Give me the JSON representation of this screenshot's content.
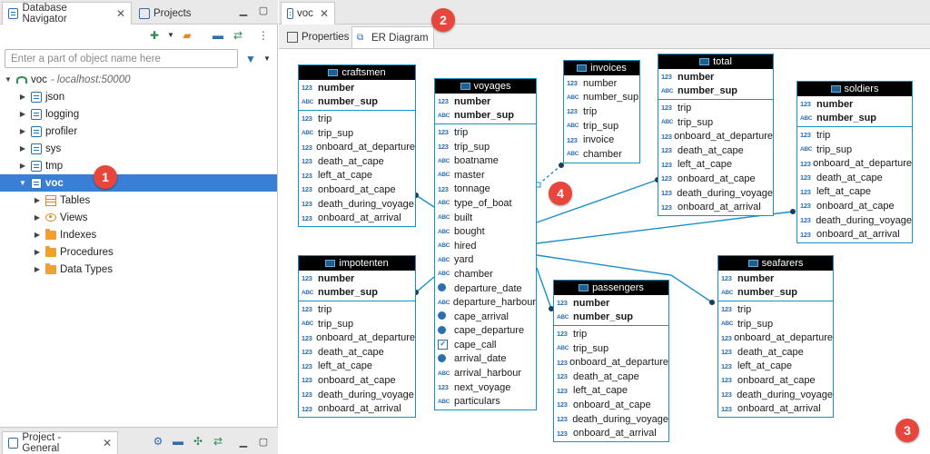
{
  "left_panel": {
    "tabs": [
      {
        "label": "Database Navigator",
        "active": true
      },
      {
        "label": "Projects",
        "active": false
      }
    ],
    "filter": {
      "placeholder": "Enter a part of object name here",
      "value": ""
    },
    "tree": [
      {
        "label": "voc",
        "sub": "- localhost:50000",
        "level": 0,
        "expanded": true,
        "icon": "connection-icon"
      },
      {
        "label": "json",
        "level": 1,
        "icon": "schema-icon"
      },
      {
        "label": "logging",
        "level": 1,
        "icon": "schema-icon"
      },
      {
        "label": "profiler",
        "level": 1,
        "icon": "schema-icon"
      },
      {
        "label": "sys",
        "level": 1,
        "icon": "schema-icon"
      },
      {
        "label": "tmp",
        "level": 1,
        "icon": "schema-icon"
      },
      {
        "label": "voc",
        "level": 1,
        "icon": "schema-icon",
        "selected": true,
        "expanded": true
      },
      {
        "label": "Tables",
        "level": 2,
        "icon": "tables-icon"
      },
      {
        "label": "Views",
        "level": 2,
        "icon": "views-icon"
      },
      {
        "label": "Indexes",
        "level": 2,
        "icon": "folder-icon"
      },
      {
        "label": "Procedures",
        "level": 2,
        "icon": "folder-icon"
      },
      {
        "label": "Data Types",
        "level": 2,
        "icon": "folder-icon"
      }
    ],
    "bottom_tab": {
      "label": "Project - General"
    }
  },
  "editor": {
    "tab": {
      "label": "voc"
    },
    "subtabs": [
      {
        "label": "Properties",
        "active": false
      },
      {
        "label": "ER Diagram",
        "active": true
      }
    ]
  },
  "badges": [
    "1",
    "2",
    "3",
    "4"
  ],
  "entities": {
    "craftsmen": {
      "name": "craftsmen",
      "keys": [
        {
          "t": "123",
          "n": "number"
        },
        {
          "t": "ABC",
          "n": "number_sup"
        }
      ],
      "cols": [
        {
          "t": "123",
          "n": "trip"
        },
        {
          "t": "ABC",
          "n": "trip_sup"
        },
        {
          "t": "123",
          "n": "onboard_at_departure"
        },
        {
          "t": "123",
          "n": "death_at_cape"
        },
        {
          "t": "123",
          "n": "left_at_cape"
        },
        {
          "t": "123",
          "n": "onboard_at_cape"
        },
        {
          "t": "123",
          "n": "death_during_voyage"
        },
        {
          "t": "123",
          "n": "onboard_at_arrival"
        }
      ]
    },
    "impotenten": {
      "name": "impotenten",
      "keys": [
        {
          "t": "123",
          "n": "number"
        },
        {
          "t": "ABC",
          "n": "number_sup"
        }
      ],
      "cols": [
        {
          "t": "123",
          "n": "trip"
        },
        {
          "t": "ABC",
          "n": "trip_sup"
        },
        {
          "t": "123",
          "n": "onboard_at_departure"
        },
        {
          "t": "123",
          "n": "death_at_cape"
        },
        {
          "t": "123",
          "n": "left_at_cape"
        },
        {
          "t": "123",
          "n": "onboard_at_cape"
        },
        {
          "t": "123",
          "n": "death_during_voyage"
        },
        {
          "t": "123",
          "n": "onboard_at_arrival"
        }
      ]
    },
    "voyages": {
      "name": "voyages",
      "keys": [
        {
          "t": "123",
          "n": "number"
        },
        {
          "t": "ABC",
          "n": "number_sup"
        }
      ],
      "cols": [
        {
          "t": "123",
          "n": "trip"
        },
        {
          "t": "123",
          "n": "trip_sup"
        },
        {
          "t": "ABC",
          "n": "boatname"
        },
        {
          "t": "ABC",
          "n": "master"
        },
        {
          "t": "123",
          "n": "tonnage"
        },
        {
          "t": "ABC",
          "n": "type_of_boat"
        },
        {
          "t": "ABC",
          "n": "built"
        },
        {
          "t": "ABC",
          "n": "bought"
        },
        {
          "t": "ABC",
          "n": "hired"
        },
        {
          "t": "ABC",
          "n": "yard"
        },
        {
          "t": "ABC",
          "n": "chamber"
        },
        {
          "t": "date",
          "n": "departure_date"
        },
        {
          "t": "ABC",
          "n": "departure_harbour"
        },
        {
          "t": "date",
          "n": "cape_arrival"
        },
        {
          "t": "date",
          "n": "cape_departure"
        },
        {
          "t": "bool",
          "n": "cape_call"
        },
        {
          "t": "date",
          "n": "arrival_date"
        },
        {
          "t": "ABC",
          "n": "arrival_harbour"
        },
        {
          "t": "123",
          "n": "next_voyage"
        },
        {
          "t": "ABC",
          "n": "particulars"
        }
      ]
    },
    "invoices": {
      "name": "invoices",
      "keys": [],
      "cols": [
        {
          "t": "123",
          "n": "number"
        },
        {
          "t": "ABC",
          "n": "number_sup"
        },
        {
          "t": "123",
          "n": "trip"
        },
        {
          "t": "ABC",
          "n": "trip_sup"
        },
        {
          "t": "123",
          "n": "invoice"
        },
        {
          "t": "ABC",
          "n": "chamber"
        }
      ]
    },
    "total": {
      "name": "total",
      "keys": [
        {
          "t": "123",
          "n": "number"
        },
        {
          "t": "ABC",
          "n": "number_sup"
        }
      ],
      "cols": [
        {
          "t": "123",
          "n": "trip"
        },
        {
          "t": "ABC",
          "n": "trip_sup"
        },
        {
          "t": "123",
          "n": "onboard_at_departure"
        },
        {
          "t": "123",
          "n": "death_at_cape"
        },
        {
          "t": "123",
          "n": "left_at_cape"
        },
        {
          "t": "123",
          "n": "onboard_at_cape"
        },
        {
          "t": "123",
          "n": "death_during_voyage"
        },
        {
          "t": "123",
          "n": "onboard_at_arrival"
        }
      ]
    },
    "soldiers": {
      "name": "soldiers",
      "keys": [
        {
          "t": "123",
          "n": "number"
        },
        {
          "t": "ABC",
          "n": "number_sup"
        }
      ],
      "cols": [
        {
          "t": "123",
          "n": "trip"
        },
        {
          "t": "ABC",
          "n": "trip_sup"
        },
        {
          "t": "123",
          "n": "onboard_at_departure"
        },
        {
          "t": "123",
          "n": "death_at_cape"
        },
        {
          "t": "123",
          "n": "left_at_cape"
        },
        {
          "t": "123",
          "n": "onboard_at_cape"
        },
        {
          "t": "123",
          "n": "death_during_voyage"
        },
        {
          "t": "123",
          "n": "onboard_at_arrival"
        }
      ]
    },
    "passengers": {
      "name": "passengers",
      "keys": [
        {
          "t": "123",
          "n": "number"
        },
        {
          "t": "ABC",
          "n": "number_sup"
        }
      ],
      "cols": [
        {
          "t": "123",
          "n": "trip"
        },
        {
          "t": "ABC",
          "n": "trip_sup"
        },
        {
          "t": "123",
          "n": "onboard_at_departure"
        },
        {
          "t": "123",
          "n": "death_at_cape"
        },
        {
          "t": "123",
          "n": "left_at_cape"
        },
        {
          "t": "123",
          "n": "onboard_at_cape"
        },
        {
          "t": "123",
          "n": "death_during_voyage"
        },
        {
          "t": "123",
          "n": "onboard_at_arrival"
        }
      ]
    },
    "seafarers": {
      "name": "seafarers",
      "keys": [
        {
          "t": "123",
          "n": "number"
        },
        {
          "t": "ABC",
          "n": "number_sup"
        }
      ],
      "cols": [
        {
          "t": "123",
          "n": "trip"
        },
        {
          "t": "ABC",
          "n": "trip_sup"
        },
        {
          "t": "123",
          "n": "onboard_at_departure"
        },
        {
          "t": "123",
          "n": "death_at_cape"
        },
        {
          "t": "123",
          "n": "left_at_cape"
        },
        {
          "t": "123",
          "n": "onboard_at_cape"
        },
        {
          "t": "123",
          "n": "death_during_voyage"
        },
        {
          "t": "123",
          "n": "onboard_at_arrival"
        }
      ]
    }
  },
  "colors": {
    "accent": "#3a7fd6",
    "entity_border": "#1a90c8",
    "relation_line": "#1a90c8",
    "badge": "#e8453c"
  }
}
